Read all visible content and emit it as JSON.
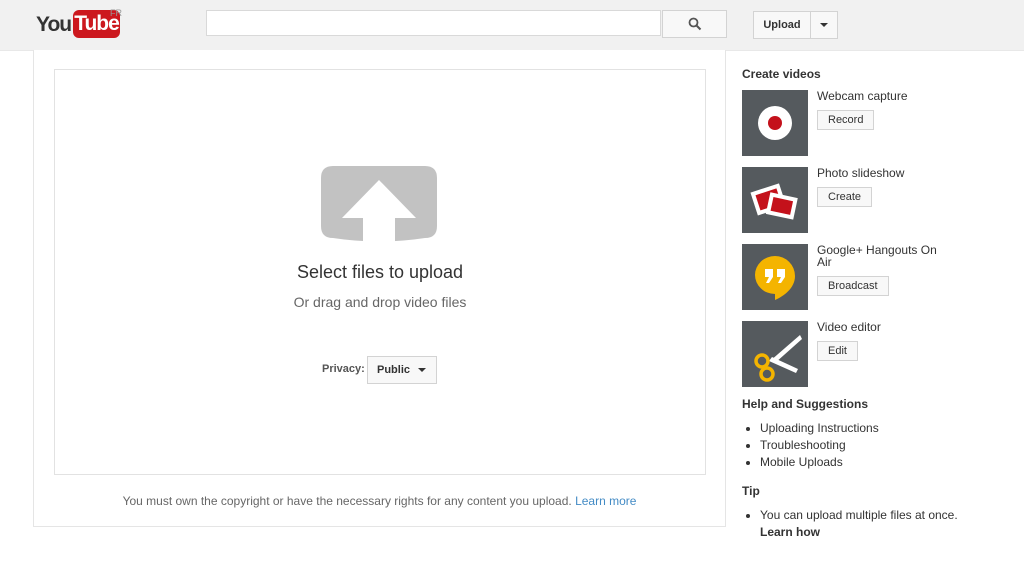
{
  "header": {
    "logo_you": "You",
    "logo_tube": "Tube",
    "logo_region": "FR",
    "search_placeholder": "",
    "search_icon": "magnifier-icon",
    "upload_label": "Upload",
    "upload_menu_icon": "caret-down-icon"
  },
  "upload_area": {
    "select_files": "Select files to upload",
    "drag_drop": "Or drag and drop video files",
    "privacy_label": "Privacy:",
    "privacy_value": "Public",
    "copyright_text": "You must own the copyright or have the necessary rights for any content you upload.",
    "learn_more": "Learn more"
  },
  "sidebar": {
    "create_heading": "Create videos",
    "tools": [
      {
        "title": "Webcam capture",
        "button": "Record",
        "icon": "record-icon"
      },
      {
        "title": "Photo slideshow",
        "button": "Create",
        "icon": "photos-icon"
      },
      {
        "title": "Google+ Hangouts On Air",
        "button": "Broadcast",
        "icon": "hangouts-icon"
      },
      {
        "title": "Video editor",
        "button": "Edit",
        "icon": "scissors-icon"
      }
    ],
    "help_heading": "Help and Suggestions",
    "help_links": [
      "Uploading Instructions",
      "Troubleshooting",
      "Mobile Uploads"
    ],
    "tip_heading": "Tip",
    "tip_text": "You can upload multiple files at once.",
    "tip_link": "Learn how"
  },
  "colors": {
    "header_bg": "#f1f1f1",
    "brand_red": "#cc181e",
    "link_blue": "#438bc5",
    "thumb_bg": "#555a5e",
    "hangouts_yellow": "#f4b400"
  }
}
